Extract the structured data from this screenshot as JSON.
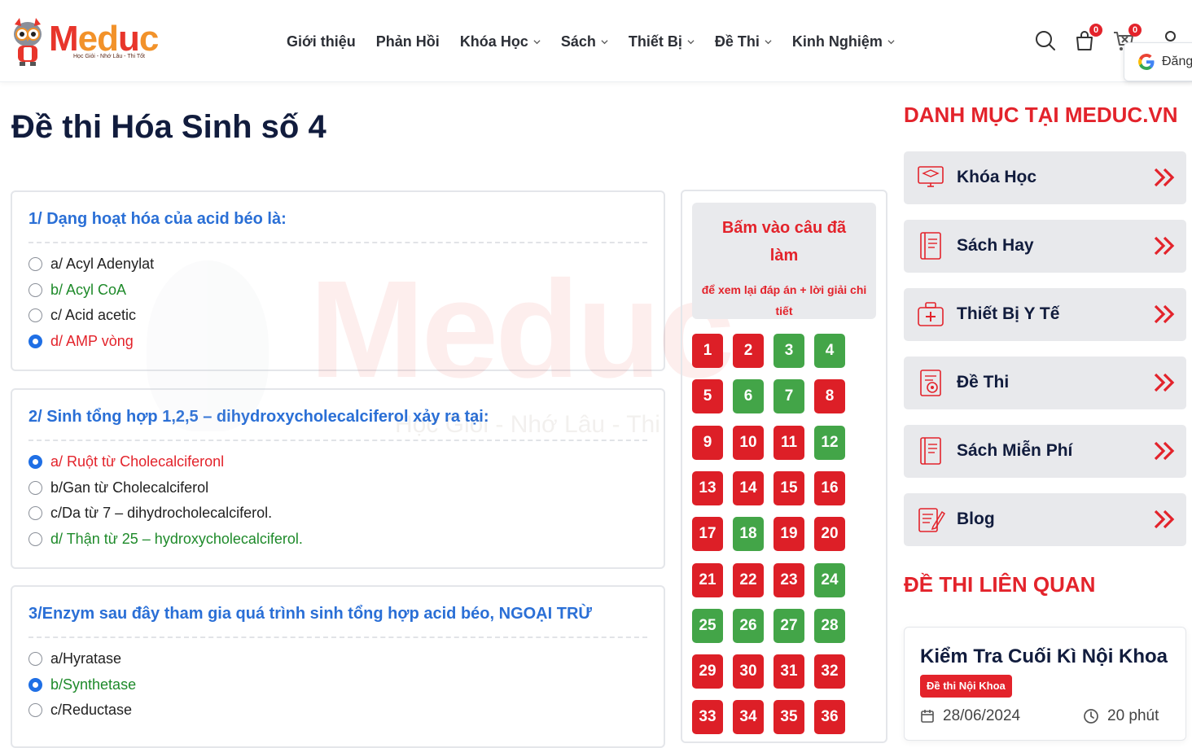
{
  "brand": {
    "logo_word": "Meduc",
    "tagline": "Học Giỏi - Nhớ Lâu - Thi Tốt",
    "colors": {
      "accent": "#e3232b",
      "orange": "#f2922a",
      "blue": "#2a6fd6",
      "navy": "#111c3d",
      "green": "#43a548"
    }
  },
  "nav": [
    {
      "label": "Giới thiệu",
      "dropdown": false
    },
    {
      "label": "Phản Hồi",
      "dropdown": false
    },
    {
      "label": "Khóa Học",
      "dropdown": true
    },
    {
      "label": "Sách",
      "dropdown": true
    },
    {
      "label": "Thiết Bị",
      "dropdown": true
    },
    {
      "label": "Đề Thi",
      "dropdown": true
    },
    {
      "label": "Kinh Nghiệm",
      "dropdown": true
    }
  ],
  "header_icons": {
    "search": "search-icon",
    "cart_count": "0",
    "compare_count": "0",
    "google_login_label": "Đăng"
  },
  "page": {
    "title": "Đề thi Hóa Sinh số 4"
  },
  "watermark": {
    "word": "Meduc",
    "tagline": "Học Giỏi - Nhớ Lâu - Thi"
  },
  "questions": [
    {
      "title": "1/ Dạng hoạt hóa của acid béo là:",
      "options": [
        {
          "text": "a/ Acyl Adenylat",
          "state": "normal",
          "checked": false
        },
        {
          "text": "b/ Acyl CoA",
          "state": "green",
          "checked": false
        },
        {
          "text": "c/ Acid acetic",
          "state": "normal",
          "checked": false
        },
        {
          "text": "d/ AMP vòng",
          "state": "red",
          "checked": true
        }
      ]
    },
    {
      "title": "2/ Sinh tổng hợp 1,2,5 – dihydroxycholecalciferol xảy ra tại:",
      "options": [
        {
          "text": "a/ Ruột từ Cholecalciferonl",
          "state": "red",
          "checked": true
        },
        {
          "text": "b/Gan từ Cholecalciferol",
          "state": "normal",
          "checked": false
        },
        {
          "text": "c/Da từ 7 – dihydrocholecalciferol.",
          "state": "normal",
          "checked": false
        },
        {
          "text": "d/ Thận từ 25 – hydroxycholecalciferol.",
          "state": "green",
          "checked": false
        }
      ]
    },
    {
      "title": "3/Enzym sau đây tham gia quá trình sinh tổng hợp acid béo, NGOẠI TRỪ",
      "options": [
        {
          "text": "a/Hyratase",
          "state": "normal",
          "checked": false
        },
        {
          "text": "b/Synthetase",
          "state": "green",
          "checked": true
        },
        {
          "text": "c/Reductase",
          "state": "normal",
          "checked": false
        }
      ]
    }
  ],
  "answer_grid": {
    "hint_main": "Bấm vào câu đã làm",
    "hint_sub": "để xem lại đáp án + lời giải chi tiết",
    "items": [
      {
        "n": "1",
        "status": "red"
      },
      {
        "n": "2",
        "status": "red"
      },
      {
        "n": "3",
        "status": "green"
      },
      {
        "n": "4",
        "status": "green"
      },
      {
        "n": "5",
        "status": "red"
      },
      {
        "n": "6",
        "status": "green"
      },
      {
        "n": "7",
        "status": "green"
      },
      {
        "n": "8",
        "status": "red"
      },
      {
        "n": "9",
        "status": "red"
      },
      {
        "n": "10",
        "status": "red"
      },
      {
        "n": "11",
        "status": "red"
      },
      {
        "n": "12",
        "status": "green"
      },
      {
        "n": "13",
        "status": "red"
      },
      {
        "n": "14",
        "status": "red"
      },
      {
        "n": "15",
        "status": "red"
      },
      {
        "n": "16",
        "status": "red"
      },
      {
        "n": "17",
        "status": "red"
      },
      {
        "n": "18",
        "status": "green"
      },
      {
        "n": "19",
        "status": "red"
      },
      {
        "n": "20",
        "status": "red"
      },
      {
        "n": "21",
        "status": "red"
      },
      {
        "n": "22",
        "status": "red"
      },
      {
        "n": "23",
        "status": "red"
      },
      {
        "n": "24",
        "status": "green"
      },
      {
        "n": "25",
        "status": "green"
      },
      {
        "n": "26",
        "status": "green"
      },
      {
        "n": "27",
        "status": "green"
      },
      {
        "n": "28",
        "status": "green"
      },
      {
        "n": "29",
        "status": "red"
      },
      {
        "n": "30",
        "status": "red"
      },
      {
        "n": "31",
        "status": "red"
      },
      {
        "n": "32",
        "status": "red"
      },
      {
        "n": "33",
        "status": "red"
      },
      {
        "n": "34",
        "status": "red"
      },
      {
        "n": "35",
        "status": "red"
      },
      {
        "n": "36",
        "status": "red"
      }
    ]
  },
  "sidebar": {
    "categories_title": "DANH MỤC TẠI MEDUC.VN",
    "categories": [
      {
        "label": "Khóa Học",
        "icon": "course-monitor-icon"
      },
      {
        "label": "Sách Hay",
        "icon": "book-icon"
      },
      {
        "label": "Thiết Bị Y Tế",
        "icon": "medical-kit-icon"
      },
      {
        "label": "Đề Thi",
        "icon": "exam-sheet-icon"
      },
      {
        "label": "Sách Miễn Phí",
        "icon": "free-book-icon"
      },
      {
        "label": "Blog",
        "icon": "blog-edit-icon"
      }
    ],
    "related_title": "ĐỀ THI LIÊN QUAN",
    "related": [
      {
        "title": "Kiểm Tra Cuối Kì Nội Khoa",
        "tag": "Đề thi Nội Khoa",
        "date": "28/06/2024",
        "duration": "20 phút"
      }
    ]
  }
}
